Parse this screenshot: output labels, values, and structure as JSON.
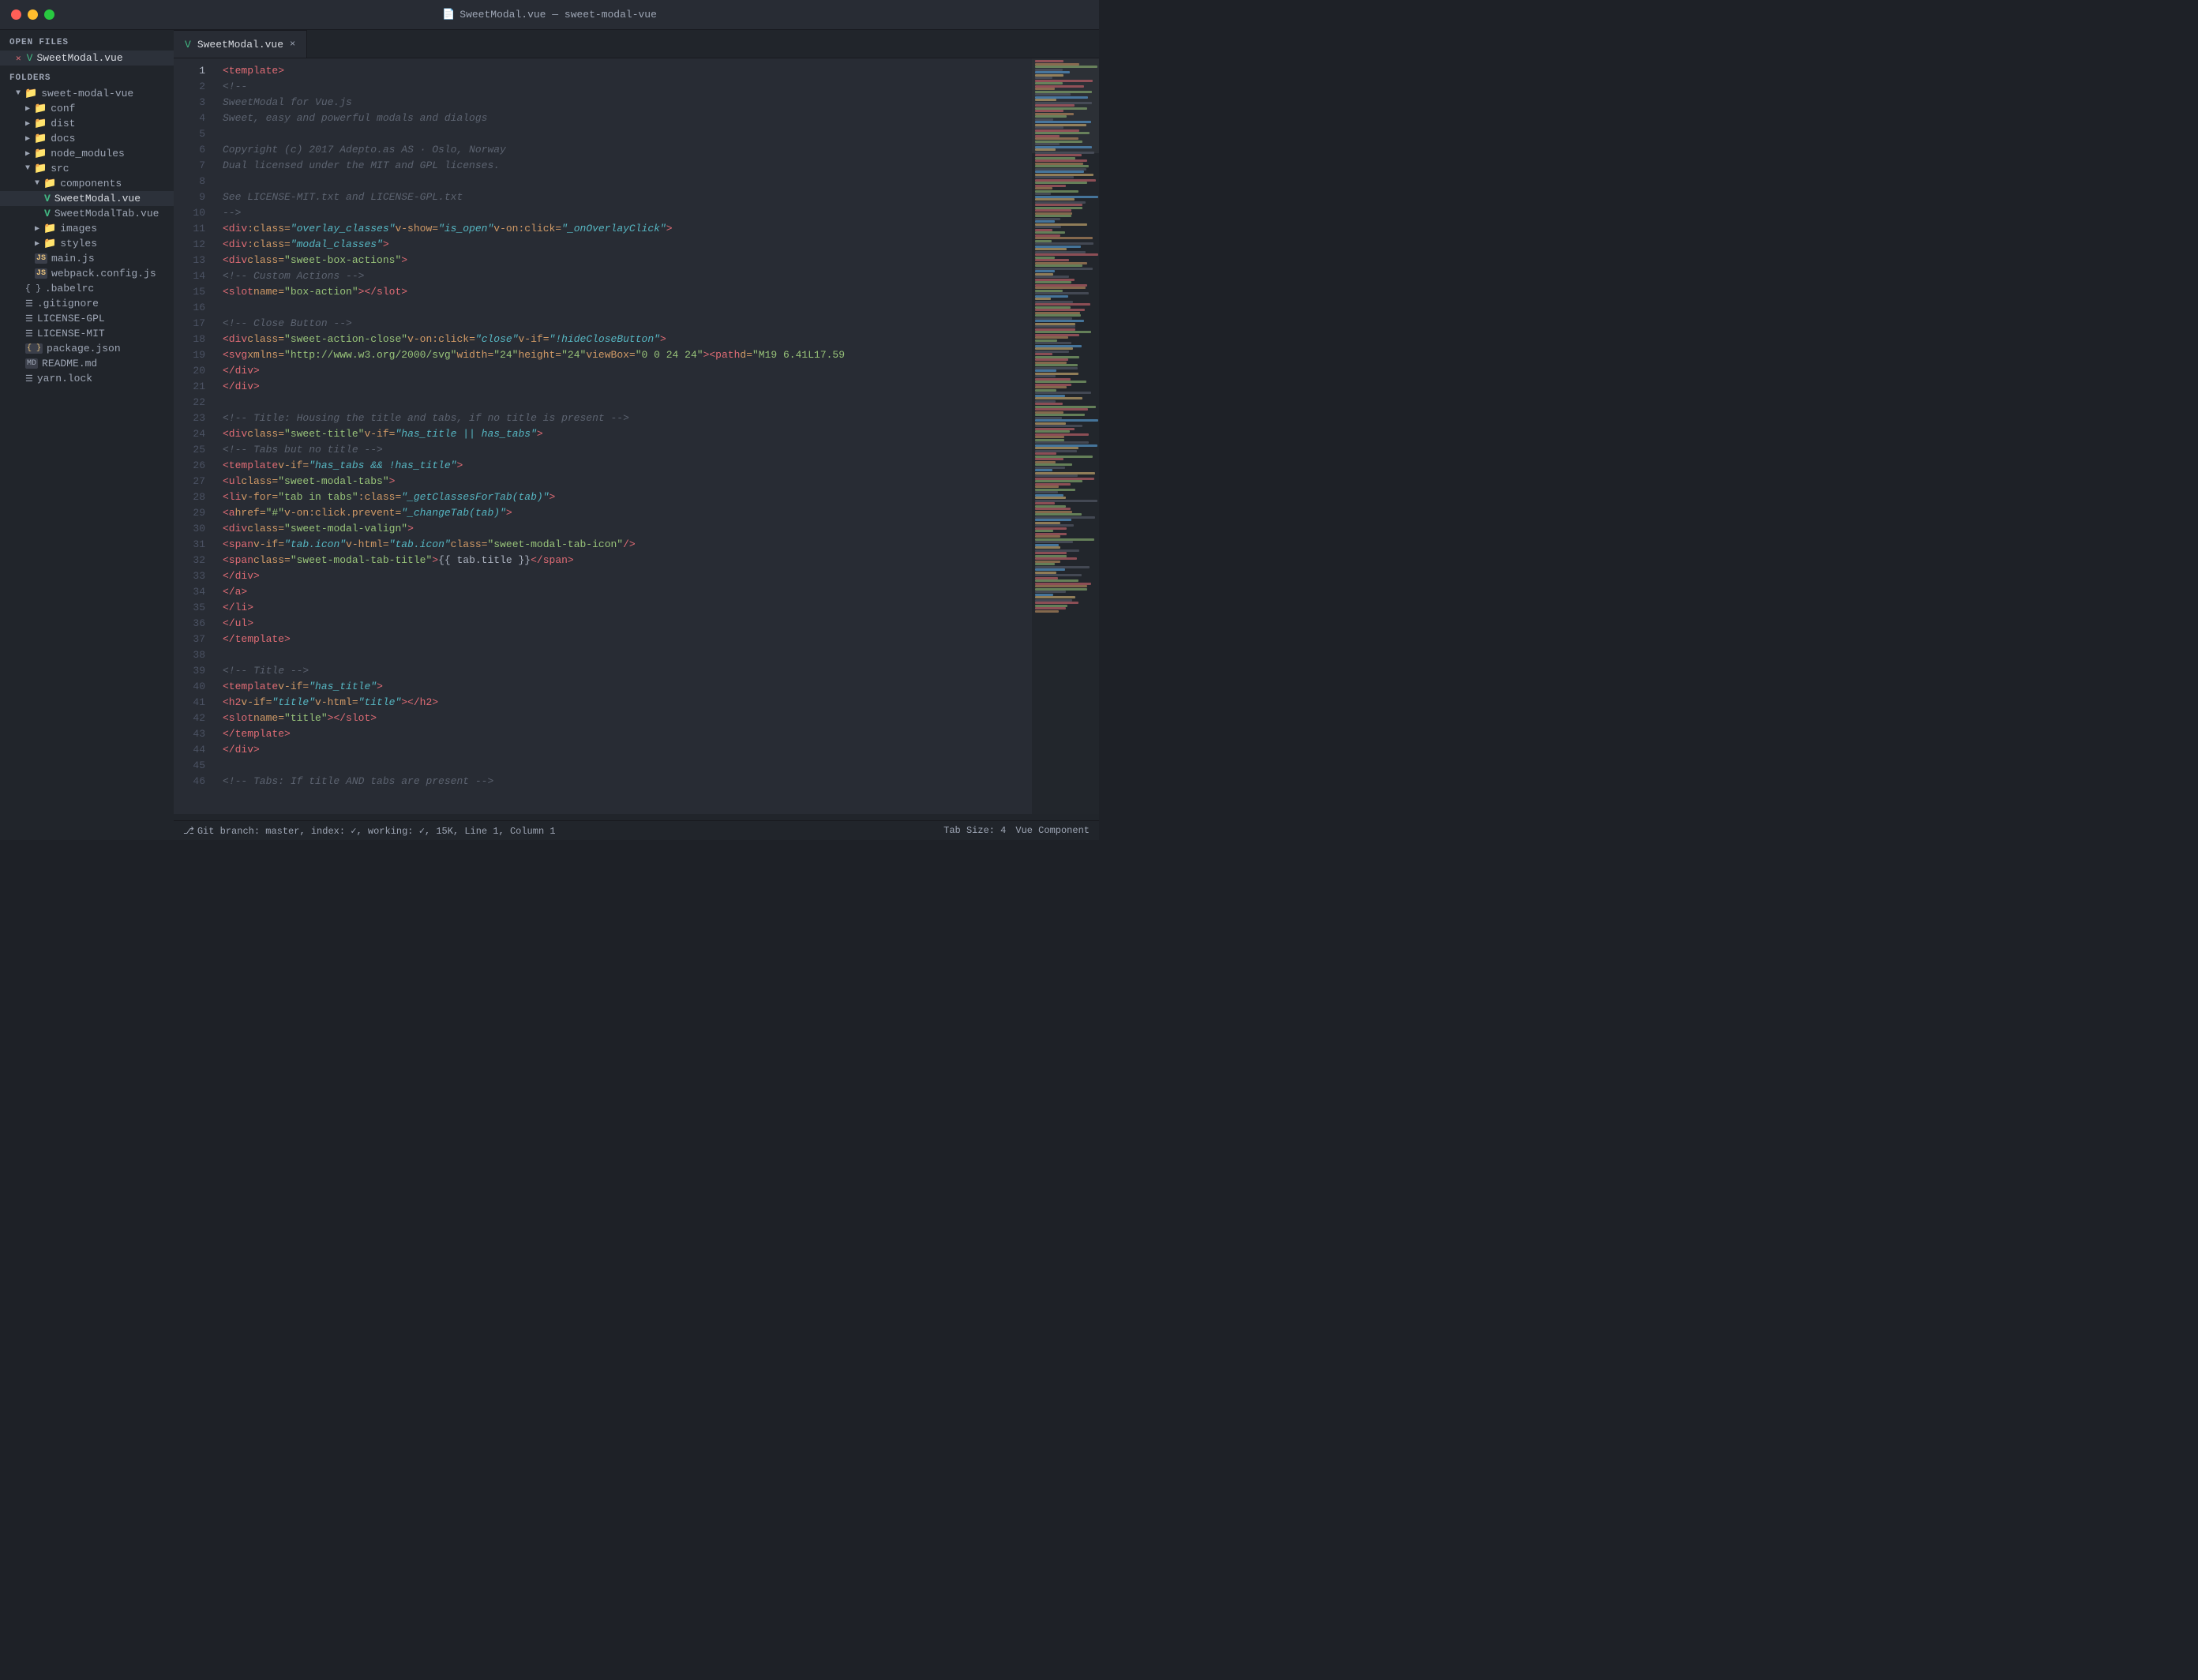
{
  "titlebar": {
    "title": "SweetModal.vue — sweet-modal-vue",
    "buttons": {
      "close": "●",
      "min": "●",
      "max": "●"
    }
  },
  "tab": {
    "filename": "SweetModal.vue",
    "close": "×"
  },
  "sidebar": {
    "open_files_label": "OPEN FILES",
    "folders_label": "FOLDERS",
    "open_files": [
      {
        "name": "SweetModal.vue",
        "active": true
      }
    ],
    "tree": [
      {
        "name": "sweet-modal-vue",
        "type": "folder-open",
        "indent": 0
      },
      {
        "name": "conf",
        "type": "folder",
        "indent": 1
      },
      {
        "name": "dist",
        "type": "folder",
        "indent": 1
      },
      {
        "name": "docs",
        "type": "folder",
        "indent": 1
      },
      {
        "name": "node_modules",
        "type": "folder",
        "indent": 1
      },
      {
        "name": "src",
        "type": "folder-open",
        "indent": 1
      },
      {
        "name": "components",
        "type": "folder-open",
        "indent": 2
      },
      {
        "name": "SweetModal.vue",
        "type": "vue-active",
        "indent": 3
      },
      {
        "name": "SweetModalTab.vue",
        "type": "vue",
        "indent": 3
      },
      {
        "name": "images",
        "type": "folder",
        "indent": 2
      },
      {
        "name": "styles",
        "type": "folder",
        "indent": 2
      },
      {
        "name": "main.js",
        "type": "js",
        "indent": 2
      },
      {
        "name": "webpack.config.js",
        "type": "js",
        "indent": 2
      },
      {
        "name": ".babelrc",
        "type": "file",
        "indent": 1
      },
      {
        "name": ".gitignore",
        "type": "file",
        "indent": 1
      },
      {
        "name": "LICENSE-GPL",
        "type": "file",
        "indent": 1
      },
      {
        "name": "LICENSE-MIT",
        "type": "file",
        "indent": 1
      },
      {
        "name": "package.json",
        "type": "json",
        "indent": 1
      },
      {
        "name": "README.md",
        "type": "md",
        "indent": 1
      },
      {
        "name": "yarn.lock",
        "type": "file",
        "indent": 1
      }
    ]
  },
  "status": {
    "git": "Git branch: master, index: ✓, working: ✓, 15K, Line 1, Column 1",
    "tab_size": "Tab Size: 4",
    "file_type": "Vue Component"
  },
  "code": {
    "lines": [
      {
        "num": 1,
        "html": "<span class='c-template'>&lt;template&gt;</span>"
      },
      {
        "num": 2,
        "html": "    <span class='c-comment'>&lt;!--</span>"
      },
      {
        "num": 3,
        "html": "        <span class='c-comment'>SweetModal for Vue.js</span>"
      },
      {
        "num": 4,
        "html": "        <span class='c-comment'>Sweet, easy and powerful modals and dialogs</span>"
      },
      {
        "num": 5,
        "html": ""
      },
      {
        "num": 6,
        "html": "        <span class='c-comment'>Copyright (c) 2017 Adepto.as AS · Oslo, Norway</span>"
      },
      {
        "num": 7,
        "html": "        <span class='c-comment'>Dual licensed under the MIT and GPL licenses.</span>"
      },
      {
        "num": 8,
        "html": ""
      },
      {
        "num": 9,
        "html": "        <span class='c-comment'>See LICENSE-MIT.txt and LICENSE-GPL.txt</span>"
      },
      {
        "num": 10,
        "html": "    <span class='c-comment'>--&gt;</span>"
      },
      {
        "num": 11,
        "html": "    <span class='c-tag'>&lt;div</span> <span class='c-attr'>:class=</span><span class='c-italic'>\"overlay_classes\"</span> <span class='c-attr'>v-show=</span><span class='c-italic'>\"is_open\"</span> <span class='c-attr'>v-on:click=</span><span class='c-italic'>\"_onOverlayClick\"</span><span class='c-tag'>&gt;</span>"
      },
      {
        "num": 12,
        "html": "        <span class='c-tag'>&lt;div</span> <span class='c-attr'>:class=</span><span class='c-italic'>\"modal_classes\"</span><span class='c-tag'>&gt;</span>"
      },
      {
        "num": 13,
        "html": "            <span class='c-tag'>&lt;div</span> <span class='c-attr'>class=</span><span class='c-string'>\"sweet-box-actions\"</span><span class='c-tag'>&gt;</span>"
      },
      {
        "num": 14,
        "html": "                <span class='c-comment'>&lt;!-- Custom Actions --&gt;</span>"
      },
      {
        "num": 15,
        "html": "                <span class='c-tag'>&lt;slot</span> <span class='c-attr'>name=</span><span class='c-string'>\"box-action\"</span><span class='c-tag'>&gt;&lt;/slot&gt;</span>"
      },
      {
        "num": 16,
        "html": ""
      },
      {
        "num": 17,
        "html": "                <span class='c-comment'>&lt;!-- Close Button --&gt;</span>"
      },
      {
        "num": 18,
        "html": "                <span class='c-tag'>&lt;div</span> <span class='c-attr'>class=</span><span class='c-string'>\"sweet-action-close\"</span> <span class='c-attr'>v-on:click=</span><span class='c-italic'>\"close\"</span> <span class='c-attr'>v-if=</span><span class='c-italic'>\"!hideCloseButton\"</span><span class='c-tag'>&gt;</span>"
      },
      {
        "num": 19,
        "html": "                    <span class='c-tag'>&lt;svg</span> <span class='c-attr'>xmlns=</span><span class='c-string'>\"http://www.w3.org/2000/svg\"</span> <span class='c-attr'>width=</span><span class='c-string'>\"24\"</span> <span class='c-attr'>height=</span><span class='c-string'>\"24\"</span> <span class='c-attr'>viewBox=</span><span class='c-string'>\"0 0 24 24\"</span><span class='c-tag'>&gt;&lt;path</span> <span class='c-attr'>d=</span><span class='c-string'>\"M19 6.41L17.59</span>"
      },
      {
        "num": 20,
        "html": "                <span class='c-tag'>&lt;/div&gt;</span>"
      },
      {
        "num": 21,
        "html": "            <span class='c-tag'>&lt;/div&gt;</span>"
      },
      {
        "num": 22,
        "html": ""
      },
      {
        "num": 23,
        "html": "            <span class='c-comment'>&lt;!-- Title: Housing the title and tabs, if no title is present --&gt;</span>"
      },
      {
        "num": 24,
        "html": "            <span class='c-tag'>&lt;div</span> <span class='c-attr'>class=</span><span class='c-string'>\"sweet-title\"</span> <span class='c-attr'>v-if=</span><span class='c-italic'>\"has_title || has_tabs\"</span><span class='c-tag'>&gt;</span>"
      },
      {
        "num": 25,
        "html": "                <span class='c-comment'>&lt;!-- Tabs but no title --&gt;</span>"
      },
      {
        "num": 26,
        "html": "                <span class='c-tag'>&lt;template</span> <span class='c-attr'>v-if=</span><span class='c-italic'>\"has_tabs &amp;&amp; !has_title\"</span><span class='c-tag'>&gt;</span>"
      },
      {
        "num": 27,
        "html": "                    <span class='c-tag'>&lt;ul</span> <span class='c-attr'>class=</span><span class='c-string'>\"sweet-modal-tabs\"</span><span class='c-tag'>&gt;</span>"
      },
      {
        "num": 28,
        "html": "                        <span class='c-tag'>&lt;li</span> <span class='c-attr'>v-for=</span><span class='c-string'>\"tab in tabs\"</span> <span class='c-attr'>:class=</span><span class='c-italic'>\"_getClassesForTab(tab)\"</span><span class='c-tag'>&gt;</span>"
      },
      {
        "num": 29,
        "html": "                            <span class='c-tag'>&lt;a</span> <span class='c-attr'>href=</span><span class='c-string'>\"#\"</span> <span class='c-attr'>v-on:click.prevent=</span><span class='c-italic'>\"_changeTab(tab)\"</span><span class='c-tag'>&gt;</span>"
      },
      {
        "num": 30,
        "html": "                                <span class='c-tag'>&lt;div</span> <span class='c-attr'>class=</span><span class='c-string'>\"sweet-modal-valign\"</span><span class='c-tag'>&gt;</span>"
      },
      {
        "num": 31,
        "html": "                                    <span class='c-tag'>&lt;span</span> <span class='c-attr'>v-if=</span><span class='c-italic'>\"tab.icon\"</span> <span class='c-attr'>v-html=</span><span class='c-italic'>\"tab.icon\"</span> <span class='c-attr'>class=</span><span class='c-string'>\"sweet-modal-tab-icon\"</span> <span class='c-tag'>/&gt;</span>"
      },
      {
        "num": 32,
        "html": "                                    <span class='c-tag'>&lt;span</span> <span class='c-attr'>class=</span><span class='c-string'>\"sweet-modal-tab-title\"</span><span class='c-tag'>&gt;</span><span class='c-text'>{{ tab.title }}</span><span class='c-tag'>&lt;/span&gt;</span>"
      },
      {
        "num": 33,
        "html": "                                <span class='c-tag'>&lt;/div&gt;</span>"
      },
      {
        "num": 34,
        "html": "                            <span class='c-tag'>&lt;/a&gt;</span>"
      },
      {
        "num": 35,
        "html": "                        <span class='c-tag'>&lt;/li&gt;</span>"
      },
      {
        "num": 36,
        "html": "                    <span class='c-tag'>&lt;/ul&gt;</span>"
      },
      {
        "num": 37,
        "html": "                <span class='c-tag'>&lt;/template&gt;</span>"
      },
      {
        "num": 38,
        "html": ""
      },
      {
        "num": 39,
        "html": "                <span class='c-comment'>&lt;!-- Title --&gt;</span>"
      },
      {
        "num": 40,
        "html": "                <span class='c-tag'>&lt;template</span> <span class='c-attr'>v-if=</span><span class='c-italic'>\"has_title\"</span><span class='c-tag'>&gt;</span>"
      },
      {
        "num": 41,
        "html": "                    <span class='c-tag'>&lt;h2</span> <span class='c-attr'>v-if=</span><span class='c-italic'>\"title\"</span> <span class='c-attr'>v-html=</span><span class='c-italic'>\"title\"</span><span class='c-tag'>&gt;&lt;/h2&gt;</span>"
      },
      {
        "num": 42,
        "html": "                    <span class='c-tag'>&lt;slot</span> <span class='c-attr'>name=</span><span class='c-string'>\"title\"</span><span class='c-tag'>&gt;&lt;/slot&gt;</span>"
      },
      {
        "num": 43,
        "html": "                <span class='c-tag'>&lt;/template&gt;</span>"
      },
      {
        "num": 44,
        "html": "            <span class='c-tag'>&lt;/div&gt;</span>"
      },
      {
        "num": 45,
        "html": ""
      },
      {
        "num": 46,
        "html": "            <span class='c-comment'>&lt;!-- Tabs: If title AND tabs are present --&gt;</span>"
      }
    ]
  }
}
